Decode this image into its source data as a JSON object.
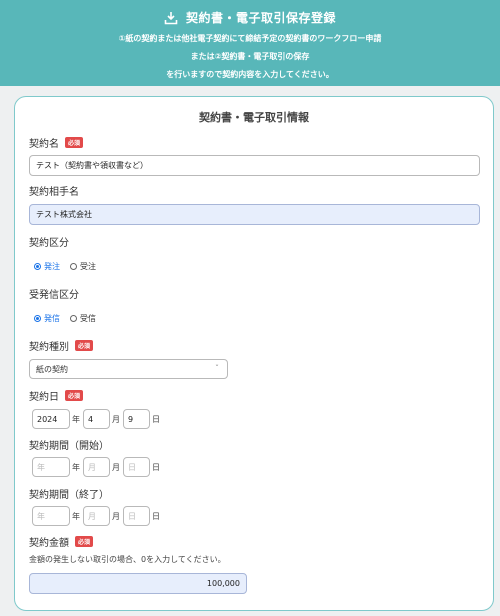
{
  "header": {
    "title": "契約書・電子取引保存登録",
    "icon": "download-tray-icon",
    "line1": "①紙の契約または他社電子契約にて締結予定の契約書のワークフロー申請",
    "line2": "または②契約書・電子取引の保存",
    "line3": "を行いますので契約内容を入力してください。"
  },
  "form": {
    "title": "契約書・電子取引情報",
    "required": "必須",
    "contract_name": {
      "label": "契約名",
      "value": "テスト（契約書や領収書など）"
    },
    "counterparty": {
      "label": "契約相手名",
      "value": "テスト株式会社"
    },
    "contract_type": {
      "label": "契約区分",
      "options": [
        "発注",
        "受注"
      ],
      "selected": "発注"
    },
    "send_type": {
      "label": "受発信区分",
      "options": [
        "発信",
        "受信"
      ],
      "selected": "発信"
    },
    "kind": {
      "label": "契約種別",
      "value": "紙の契約"
    },
    "date": {
      "label": "契約日",
      "year": "2024",
      "month": "4",
      "day": "9"
    },
    "period_start": {
      "label": "契約期間（開始）"
    },
    "period_end": {
      "label": "契約期間（終了）"
    },
    "units": {
      "year": "年",
      "month": "月",
      "day": "日"
    },
    "amount": {
      "label": "契約金額",
      "note": "金額の発生しない取引の場合、0を入力してください。",
      "value": "100,000"
    }
  }
}
